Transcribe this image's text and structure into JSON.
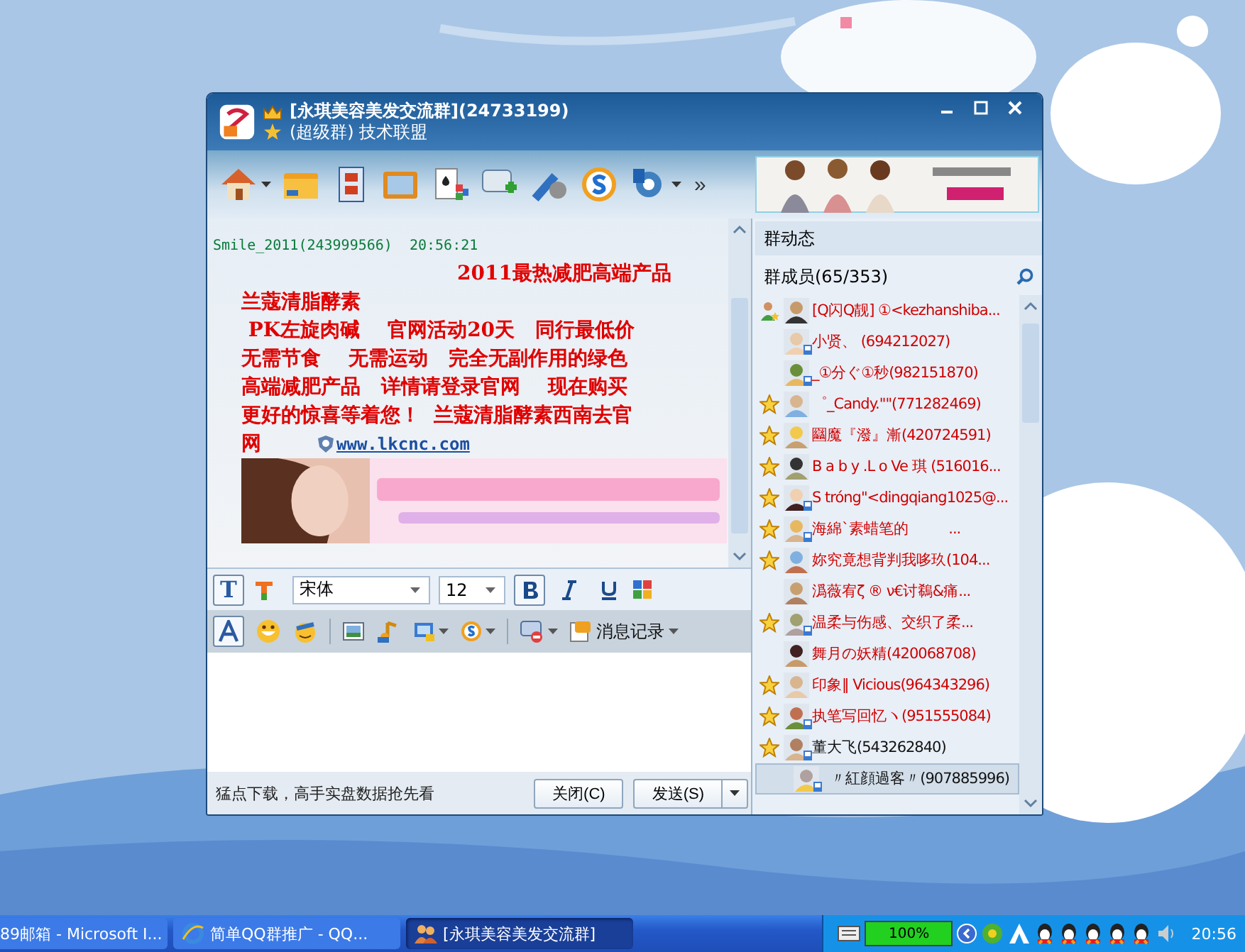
{
  "window": {
    "title": "[永琪美容美发交流群](24733199)",
    "subtitle": "(超级群) 技术联盟",
    "toolbar_more": "»"
  },
  "chat": {
    "messages": [
      {
        "sender": "Smile_2011(243999566)",
        "time": "20:56:21",
        "lines": [
          "2011最热减肥高端产品",
          "兰蔻清脂酵素",
          " PK左旋肉碱    官网活动20天   同行最低价",
          "无需节食    无需运动   完全无副作用的绿色",
          "高端减肥产品   详情请登录官网    现在购买",
          "更好的惊喜等着您！  兰蔻清脂酵素西南去官",
          "网"
        ],
        "link": "www.lkcnc.com"
      }
    ]
  },
  "format_bar": {
    "text_icon": "T",
    "font": "宋体",
    "size": "12",
    "bold": true,
    "italic": false,
    "underline": false
  },
  "history_button": "消息记录",
  "status_text": "猛点下载，高手实盘数据抢先看",
  "buttons": [
    {
      "label": "关闭(C)",
      "dropdown": false
    },
    {
      "label": "发送(S)",
      "dropdown": true
    }
  ],
  "side": {
    "feed_title": "群动态",
    "members_title": "群成员(65/353)",
    "members": [
      {
        "name": "[Q闪Q靓] ①<kezhanshiba...",
        "kind": "owner",
        "highlighted": true,
        "mobile": false,
        "selected": false
      },
      {
        "name": "小贤、 (694212027)",
        "kind": "member",
        "highlighted": true,
        "mobile": true,
        "selected": false
      },
      {
        "name": "_①分ぐ①秒(982151870)",
        "kind": "member",
        "highlighted": true,
        "mobile": true,
        "selected": false
      },
      {
        "name": "゜_Candy.\"\"(771282469)",
        "kind": "star",
        "highlighted": true,
        "mobile": false,
        "selected": false
      },
      {
        "name": "圝魔『潑』漸(420724591)",
        "kind": "star",
        "highlighted": true,
        "mobile": false,
        "selected": false
      },
      {
        "name": "B a b y .L o Ve 琪 (516016...",
        "kind": "star",
        "highlighted": true,
        "mobile": false,
        "selected": false
      },
      {
        "name": "S tróng\"<dingqiang1025@...",
        "kind": "star",
        "highlighted": true,
        "mobile": true,
        "selected": false
      },
      {
        "name": "海綿ˋ素蜡笔的          ...",
        "kind": "star",
        "highlighted": true,
        "mobile": true,
        "selected": false
      },
      {
        "name": "妳究竟想背判我哆玖(104...",
        "kind": "star",
        "highlighted": true,
        "mobile": false,
        "selected": false
      },
      {
        "name": "潙薇宥ζ ® ν€讨鵗&痛...",
        "kind": "member",
        "highlighted": true,
        "mobile": false,
        "selected": false
      },
      {
        "name": "温柔与伤感、交织了柔...",
        "kind": "star",
        "highlighted": true,
        "mobile": true,
        "selected": false
      },
      {
        "name": "舞月の妖精(420068708)",
        "kind": "member",
        "highlighted": true,
        "mobile": false,
        "selected": false
      },
      {
        "name": "印象‖ Vicious(964343296)",
        "kind": "star",
        "highlighted": true,
        "mobile": false,
        "selected": false
      },
      {
        "name": "执笔写回忆ヽ(951555084)",
        "kind": "star",
        "highlighted": true,
        "mobile": true,
        "selected": false
      },
      {
        "name": "董大飞(543262840)",
        "kind": "star",
        "highlighted": false,
        "mobile": true,
        "selected": false
      },
      {
        "name": "〃紅顔過客〃(907885996)",
        "kind": "member",
        "highlighted": false,
        "mobile": true,
        "selected": true
      }
    ]
  },
  "taskbar": {
    "tasks": [
      {
        "label": "89邮箱 - Microsoft I...",
        "selected": false,
        "kind": "plain"
      },
      {
        "label": "简单QQ群推广 - QQ...",
        "selected": false,
        "kind": "browser"
      },
      {
        "label": "[永琪美容美发交流群]",
        "selected": true,
        "kind": "group"
      }
    ],
    "battery": {
      "level": 1,
      "label": "100%"
    },
    "clock": "20:56"
  }
}
